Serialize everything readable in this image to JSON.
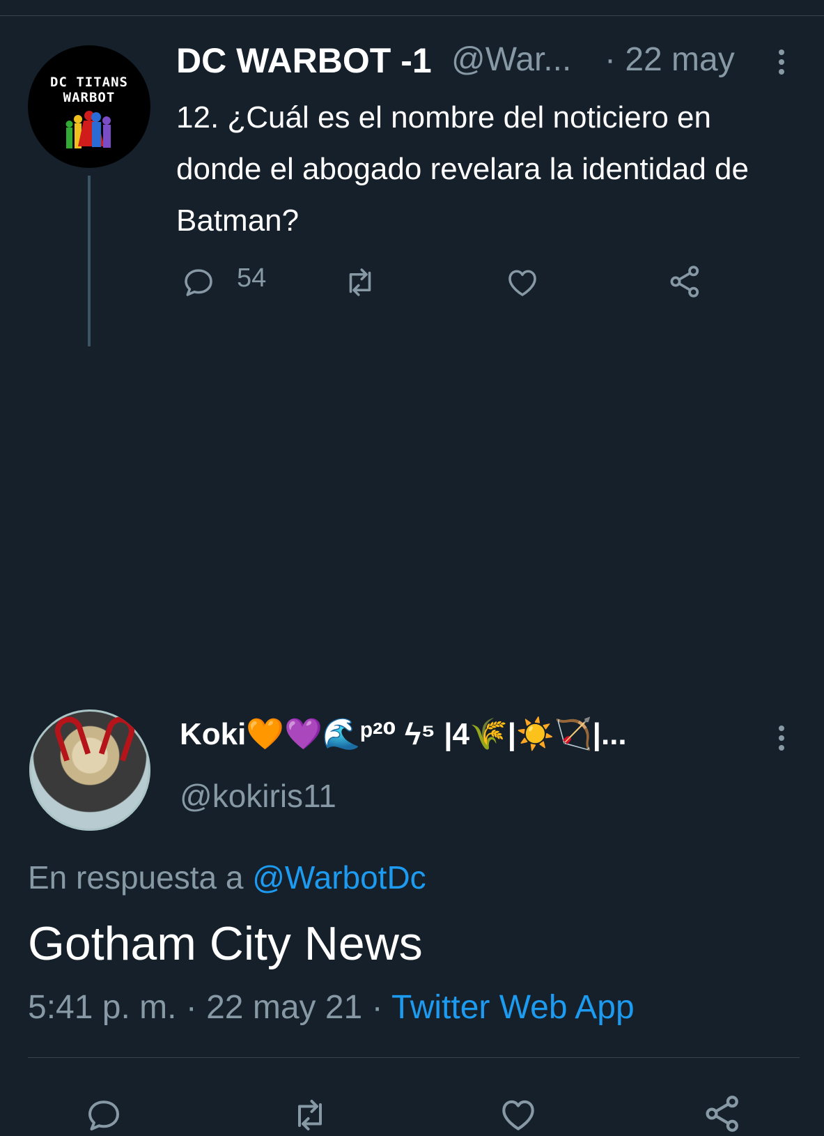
{
  "parent_tweet": {
    "avatar_text": "DC TITANS WARBOT",
    "display_name": "DC WARBOT -1",
    "handle": "@War...",
    "date": "· 22 may",
    "text": "12. ¿Cuál es el nombre del noticiero en donde el abogado revelara la identidad de Batman?",
    "reply_count": "54"
  },
  "reply_tweet": {
    "display_name": "Koki🧡💜🌊ᵖ²⁰ ϟ⁵ |4🌾|☀️🏹|...",
    "handle": "@kokiris11",
    "in_reply_prefix": "En respuesta a",
    "in_reply_handle": "@WarbotDc",
    "text": "Gotham City News",
    "time_date": "5:41 p. m. · 22 may 21 ·",
    "source": "Twitter Web App"
  },
  "theme": {
    "background": "#15202b",
    "secondary_text": "#8899a6",
    "link": "#1d9bf0",
    "divider": "#38444d"
  },
  "icons": [
    "reply-icon",
    "retweet-icon",
    "like-icon",
    "share-icon",
    "more-icon"
  ]
}
